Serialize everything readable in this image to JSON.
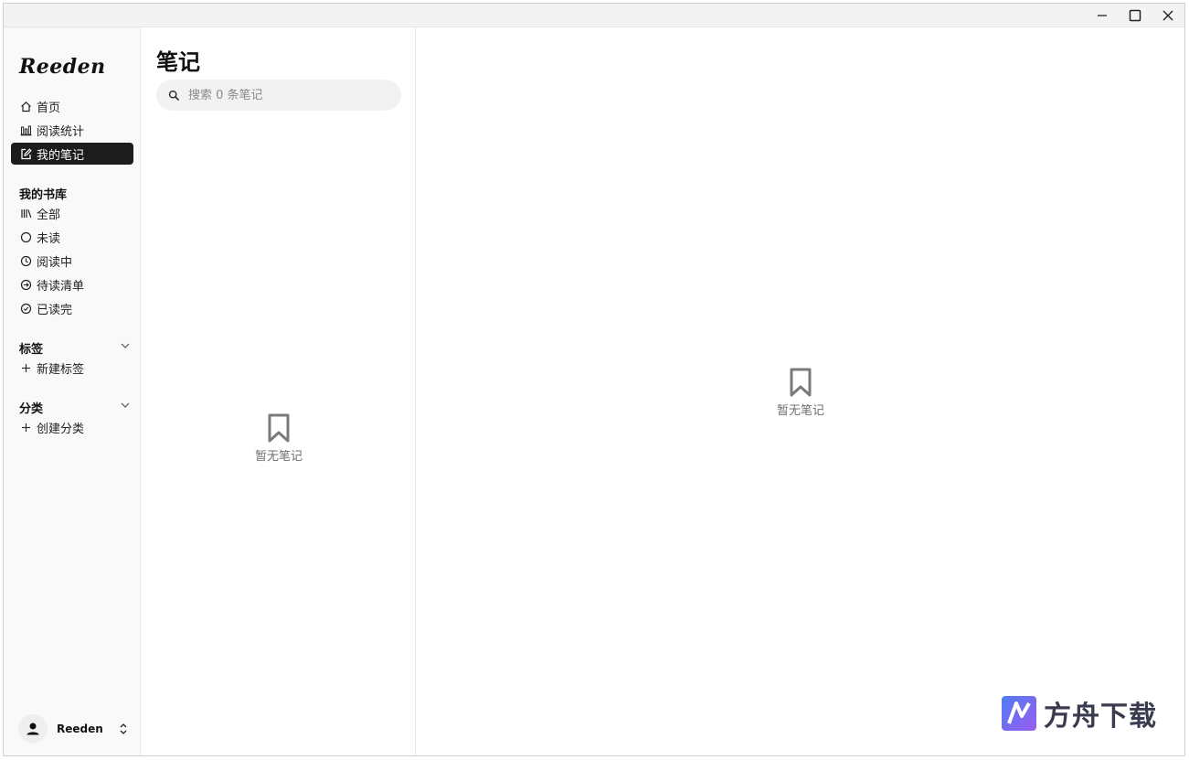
{
  "app": {
    "logo_text": "Reeden"
  },
  "sidebar": {
    "nav": [
      {
        "label": "首页",
        "icon": "home-icon"
      },
      {
        "label": "阅读统计",
        "icon": "stats-icon"
      },
      {
        "label": "我的笔记",
        "icon": "note-edit-icon",
        "active": true
      }
    ],
    "library": {
      "title": "我的书库",
      "items": [
        {
          "label": "全部",
          "icon": "books-icon"
        },
        {
          "label": "未读",
          "icon": "circle-icon"
        },
        {
          "label": "阅读中",
          "icon": "clock-icon"
        },
        {
          "label": "待读清单",
          "icon": "arrow-circle-icon"
        },
        {
          "label": "已读完",
          "icon": "check-circle-icon"
        }
      ]
    },
    "tags": {
      "title": "标签",
      "add_label": "新建标签"
    },
    "categories": {
      "title": "分类",
      "add_label": "创建分类"
    },
    "user": {
      "name": "Reeden"
    }
  },
  "notes_list": {
    "title": "笔记",
    "search_placeholder": "搜索 0 条笔记",
    "empty_text": "暂无笔记"
  },
  "detail": {
    "empty_text": "暂无笔记"
  },
  "watermark": {
    "text": "方舟下载"
  },
  "colors": {
    "active_bg": "#1c1c1c",
    "sidebar_bg": "#f9f9f9",
    "empty_icon": "#7a7a7a"
  }
}
